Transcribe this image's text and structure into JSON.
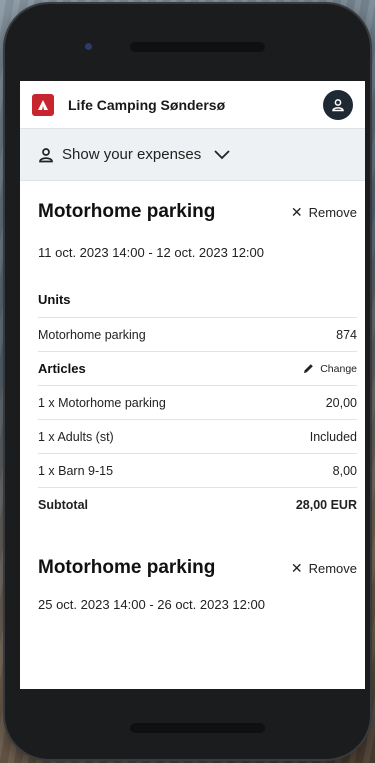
{
  "app": {
    "title": "Life Camping Søndersø"
  },
  "expenses": {
    "label": "Show your expenses"
  },
  "bookings": [
    {
      "title": "Motorhome parking",
      "remove_label": "Remove",
      "dates": "11 oct. 2023 14:00 - 12 oct. 2023 12:00",
      "units_label": "Units",
      "units": [
        {
          "name": "Motorhome parking",
          "value": "874"
        }
      ],
      "articles_label": "Articles",
      "change_label": "Change",
      "articles": [
        {
          "name": "1 x Motorhome parking",
          "value": "20,00"
        },
        {
          "name": "1 x Adults (st)",
          "value": "Included"
        },
        {
          "name": "1 x Barn 9-15",
          "value": "8,00"
        }
      ],
      "subtotal_label": "Subtotal",
      "subtotal_value": "28,00 EUR"
    },
    {
      "title": "Motorhome parking",
      "remove_label": "Remove",
      "dates": "25 oct. 2023 14:00 - 26 oct. 2023 12:00"
    }
  ],
  "colors": {
    "brand_red": "#c8262e",
    "avatar_dark": "#1f2933",
    "bar_bg": "#eef1f3"
  },
  "icons": {
    "logo": "camping-logo-icon",
    "avatar": "user-icon",
    "expenses": "user-icon",
    "dropdown": "chevron-down-icon",
    "remove": "close-icon",
    "change": "pencil-icon"
  }
}
